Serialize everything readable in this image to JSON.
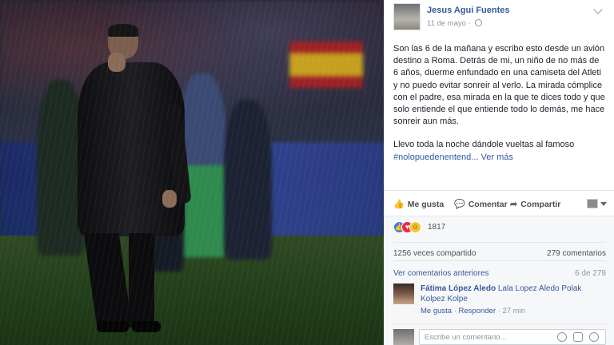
{
  "post": {
    "author": "Jesus Agui Fuentes",
    "date": "11 de mayo",
    "date_sep": "·",
    "paragraph1": "Son las 6 de la mañana y escribo esto desde un avión destino a Roma. Detrás de mi, un niño de no más de 6 años, duerme enfundado en una camiseta del Atleti y no puedo evitar sonreir al verlo. La mirada cómplice con el padre, esa mirada en la que te dices todo y que solo entiende el que entiende todo lo demás, me hace sonreir aun más.",
    "paragraph2_text": "Llevo toda la noche dándole vueltas al famoso",
    "hashtag": "#nolopuedenentend...",
    "see_more": "Ver más"
  },
  "actions": {
    "like": "Me gusta",
    "comment": "Comentar",
    "share": "Compartir",
    "like_icon": "thumbs-up-icon",
    "comment_icon": "speech-bubble-icon",
    "share_icon": "share-arrow-icon"
  },
  "reactions": {
    "count": "1817",
    "types": [
      "like",
      "love",
      "haha"
    ]
  },
  "stats": {
    "shares": "1256 veces compartido",
    "comments": "279 comentarios"
  },
  "comments": {
    "previous_link": "Ver comentarios anteriores",
    "page_count": "6 de 279",
    "items": [
      {
        "name": "Fátima López Aledo",
        "text": "Lala Lopez Aledo Polak Kolpez Kolpe",
        "like": "Me gusta",
        "reply": "Responder",
        "time": "27 min",
        "sep": "·"
      }
    ],
    "compose_placeholder": "Escribe un comentario..."
  },
  "colors": {
    "link_blue": "#365899",
    "like_blue": "#3b7bf5",
    "love_red": "#f0284a",
    "haha_yellow": "#f7c532"
  }
}
